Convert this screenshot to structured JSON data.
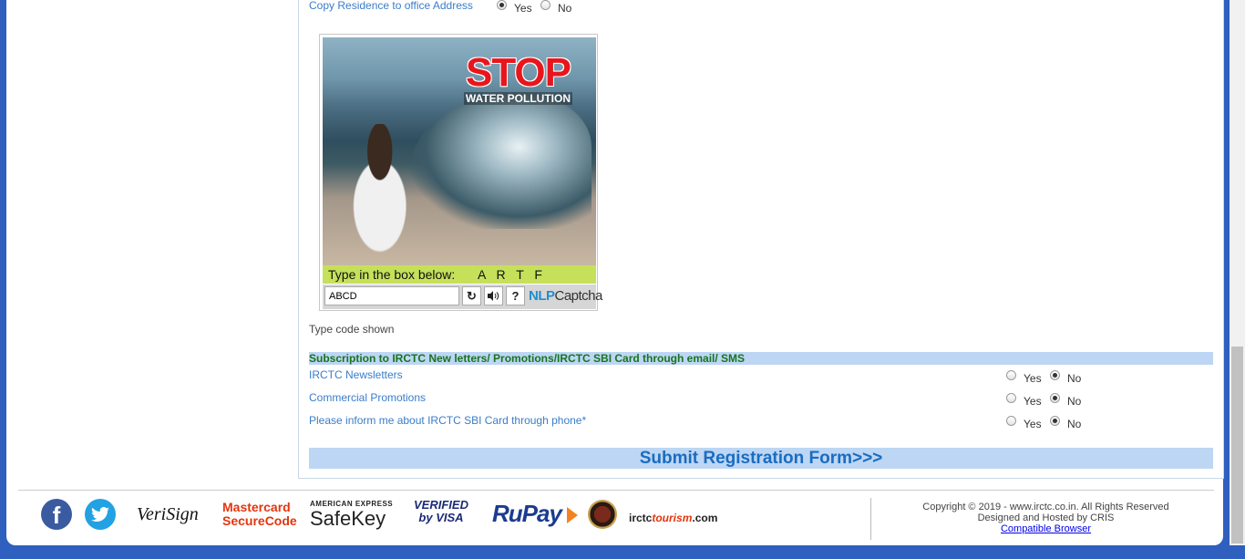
{
  "form": {
    "copy_address_label": "Copy Residence to office Address",
    "copy_address_yes": "Yes",
    "copy_address_no": "No",
    "copy_address_selected": "Yes"
  },
  "captcha": {
    "image_heading": "STOP",
    "image_subheading": "WATER POLLUTION",
    "prompt_label": "Type in the box below:",
    "code": "A R T F",
    "input_value": "ABCD",
    "refresh_icon": "refresh-icon",
    "audio_icon": "speaker-icon",
    "help_icon": "question-icon",
    "brand_nlp": "NLP",
    "brand_captcha": "Captcha",
    "hint": "Type code shown"
  },
  "subscription": {
    "header": "Subscription to IRCTC New letters/ Promotions/IRCTC SBI Card through email/ SMS",
    "items": [
      {
        "label": "IRCTC Newsletters",
        "yes": "Yes",
        "no": "No",
        "selected": "No"
      },
      {
        "label": "Commercial Promotions",
        "yes": "Yes",
        "no": "No",
        "selected": "No"
      },
      {
        "label": "Please inform me about IRCTC SBI Card through phone*",
        "yes": "Yes",
        "no": "No",
        "selected": "No"
      }
    ]
  },
  "submit_label": "Submit Registration Form>>>",
  "footer": {
    "facebook_icon": "f",
    "twitter_icon": "twitter-bird-icon",
    "verisign": "VeriSign",
    "mastercard_line1": "Mastercard",
    "mastercard_line2": "SecureCode",
    "amex": "AMERICAN EXPRESS",
    "safekey": "SafeKey",
    "verified_line1": "VERIFIED",
    "verified_line2": "by VISA",
    "rupay": "RuPay",
    "irctc_prefix": "irctc",
    "irctc_mid": "tourism",
    "irctc_suffix": ".com",
    "copyright": "Copyright © 2019 - www.irctc.co.in. All Rights Reserved",
    "hosted": "Designed and Hosted by CRIS",
    "compatible_link": "Compatible Browser"
  },
  "colors": {
    "frame_blue": "#2f5fbf",
    "label_blue": "#3a7dc9",
    "header_bg": "#bcd6f4",
    "header_text": "#17741d",
    "submit_text": "#1a6cc1"
  }
}
